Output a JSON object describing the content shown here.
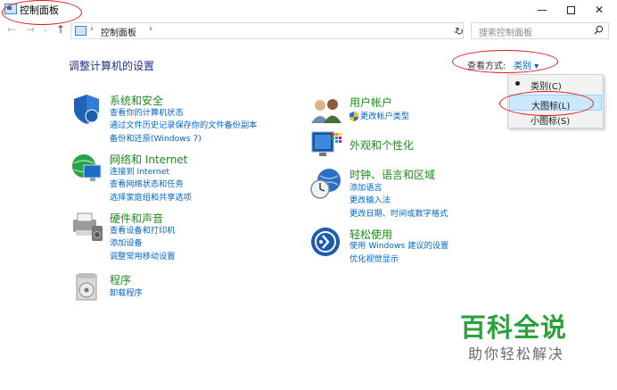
{
  "window": {
    "title": "控制面板",
    "min": "—",
    "close": "✕"
  },
  "nav": {
    "back": "←",
    "forward": "→",
    "up": "↑",
    "sep": "›",
    "address": "控制面板",
    "dropdown": "⌄",
    "refresh": "↻"
  },
  "search": {
    "placeholder": "搜索控制面板"
  },
  "page": {
    "title": "调整计算机的设置"
  },
  "view": {
    "label": "查看方式:",
    "value": "类别 ▾"
  },
  "menu": {
    "items": [
      "类别(C)",
      "大图标(L)",
      "小图标(S)"
    ]
  },
  "categories": {
    "system": {
      "title": "系统和安全",
      "links": [
        "查看你的计算机状态",
        "通过文件历史记录保存你的文件备份副本",
        "备份和还原(Windows 7)"
      ]
    },
    "network": {
      "title": "网络和 Internet",
      "links": [
        "连接到 Internet",
        "查看网络状态和任务",
        "选择家庭组和共享选项"
      ]
    },
    "hardware": {
      "title": "硬件和声音",
      "links": [
        "查看设备和打印机",
        "添加设备",
        "调整常用移动设置"
      ]
    },
    "programs": {
      "title": "程序",
      "links": [
        "卸载程序"
      ]
    },
    "users": {
      "title": "用户帐户",
      "links": [
        "更改帐户类型"
      ]
    },
    "appearance": {
      "title": "外观和个性化"
    },
    "clock": {
      "title": "时钟、语言和区域",
      "links": [
        "添加语言",
        "更改输入法",
        "更改日期、时间或数字格式"
      ]
    },
    "ease": {
      "title": "轻松使用",
      "links": [
        "使用 Windows 建议的设置",
        "优化视觉显示"
      ]
    }
  },
  "watermark": {
    "title": "百科全说",
    "subtitle": "助你轻松解决"
  },
  "colors": {
    "category_title": "#1e8c1e",
    "link": "#0066cc",
    "heading": "#1e3287",
    "highlight": "#e0141e",
    "menu_selected": "#cce8ff"
  }
}
